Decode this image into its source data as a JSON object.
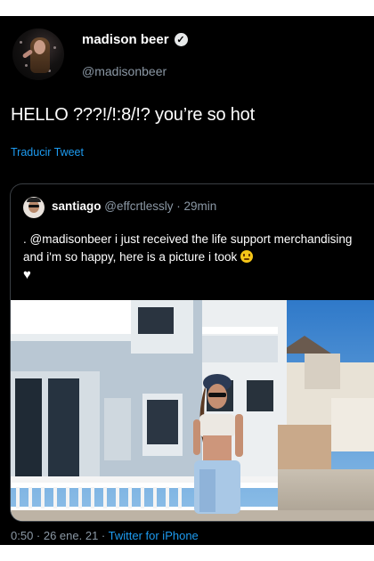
{
  "tweet": {
    "author_name": "madison beer",
    "author_handle": "@madisonbeer",
    "text": "HELLO ???!/!:8/!? you’re so hot",
    "translate_label": "Traducir Tweet",
    "timestamp": "0:50 · 26 ene. 21 · ",
    "client": "Twitter for iPhone"
  },
  "quoted": {
    "author_name": "santiago",
    "author_handle": "@effcrtlessly",
    "time": " · 29min",
    "text": ". @madisonbeer i just received the life support merchandising and i'm so happy, here is a picture i took",
    "heart": "♥"
  },
  "icons": {
    "verified": "verified-badge-icon",
    "emoji": "smiling-face-emoji-icon",
    "heart": "white-heart-emoji-icon"
  },
  "colors": {
    "background": "#000000",
    "text": "#ffffff",
    "secondary": "#8b98a5",
    "link": "#1d9bf0"
  }
}
